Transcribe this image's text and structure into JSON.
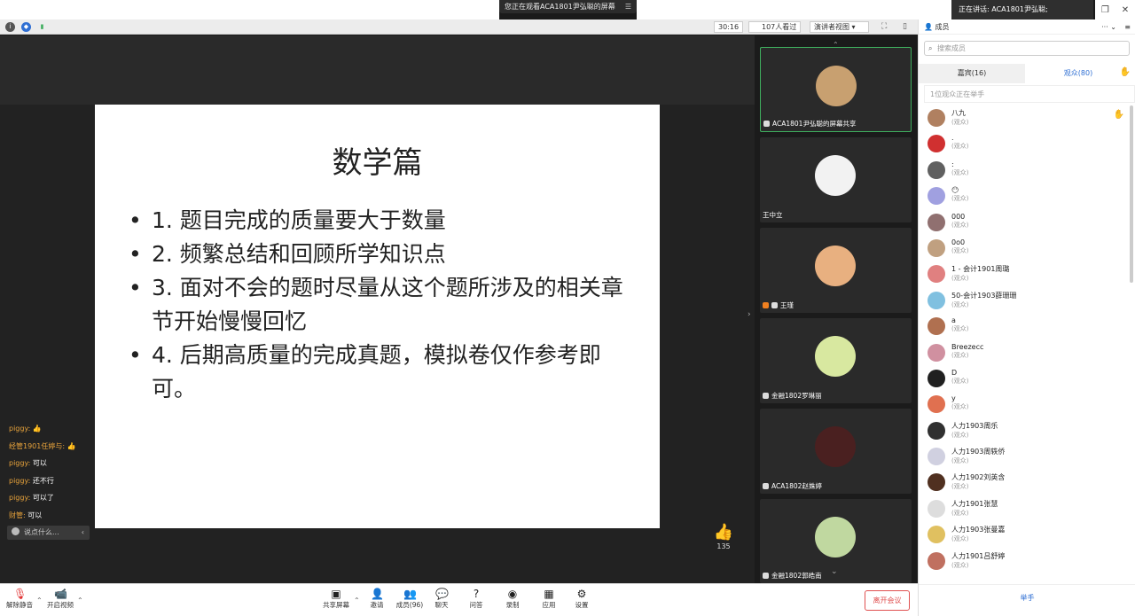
{
  "banner": {
    "text": "您正在观看ACA1801尹弘聪的屏幕"
  },
  "speaker": {
    "text": "正在讲话: ACA1801尹弘聪;"
  },
  "toolbar": {
    "timer": "30:16",
    "viewers": "107人看过",
    "view_mode": "演讲者视图",
    "members_title": "成员"
  },
  "slide": {
    "title": "数学篇",
    "bullets": [
      "1. 题目完成的质量要大于数量",
      "2. 频繁总结和回顾所学知识点",
      "3. 面对不会的题时尽量从这个题所涉及的相关章节开始慢慢回忆",
      "4. 后期高质量的完成真题，模拟卷仅作参考即可。"
    ]
  },
  "chat": {
    "messages": [
      {
        "name": "piggy:",
        "text": "👍"
      },
      {
        "name": "经管1901任婷与:",
        "text": "👍"
      },
      {
        "name": "piggy:",
        "text": "可以"
      },
      {
        "name": "piggy:",
        "text": "还不行"
      },
      {
        "name": "piggy:",
        "text": "可以了"
      },
      {
        "name": "财管:",
        "text": "可以"
      }
    ],
    "placeholder": "说点什么..."
  },
  "likes": {
    "count": "135"
  },
  "videos": [
    {
      "name": "ACA1801尹弘聪的屏幕共享",
      "color": "#c8a070"
    },
    {
      "name": "王中立",
      "color": "#f2f2f2"
    },
    {
      "name": "王瑾",
      "color": "#e8b080"
    },
    {
      "name": "金融1802罗琳丽",
      "color": "#d8e8a0"
    },
    {
      "name": "ACA1802赵姝婷",
      "color": "#4a2020"
    },
    {
      "name": "金融1802郭皓南",
      "color": "#c0d8a0"
    }
  ],
  "panel": {
    "search_placeholder": "搜索成员",
    "tab_hosts": "嘉宾(16)",
    "tab_audience": "观众(80)",
    "hand_banner": "1位观众正在举手",
    "raise_hand": "举手",
    "members": [
      {
        "name": "八九",
        "role": "(观众)",
        "color": "#b08060"
      },
      {
        "name": ".",
        "role": "(观众)",
        "color": "#d03030"
      },
      {
        "name": ":",
        "role": "(观众)",
        "color": "#606060"
      },
      {
        "name": "😶",
        "role": "(观众)",
        "color": "#a0a0e0"
      },
      {
        "name": "000",
        "role": "(观众)",
        "color": "#907070"
      },
      {
        "name": "0o0",
        "role": "(观众)",
        "color": "#c0a080"
      },
      {
        "name": "1 - 会计1901周璐",
        "role": "(观众)",
        "color": "#e08080"
      },
      {
        "name": "50-会计1903薛珊珊",
        "role": "(观众)",
        "color": "#80c0e0"
      },
      {
        "name": "a",
        "role": "(观众)",
        "color": "#b07050"
      },
      {
        "name": "Breezecc",
        "role": "(观众)",
        "color": "#d090a0"
      },
      {
        "name": "D",
        "role": "(观众)",
        "color": "#202020"
      },
      {
        "name": "y",
        "role": "(观众)",
        "color": "#e07050"
      },
      {
        "name": "人力1903周乐",
        "role": "(观众)",
        "color": "#303030"
      },
      {
        "name": "人力1903周轶侨",
        "role": "(观众)",
        "color": "#d0d0e0"
      },
      {
        "name": "人力1902刘英含",
        "role": "(观众)",
        "color": "#503020"
      },
      {
        "name": "人力1901张慧",
        "role": "(观众)",
        "color": "#dddddd"
      },
      {
        "name": "人力1903张曼嘉",
        "role": "(观众)",
        "color": "#e0c060"
      },
      {
        "name": "人力1901吕舒婷",
        "role": "(观众)",
        "color": "#c07060"
      }
    ]
  },
  "bottom": {
    "mute": "解除静音",
    "video": "开启视频",
    "share": "共享屏幕",
    "invite": "邀请",
    "members": "成员(96)",
    "chat": "聊天",
    "qa": "问答",
    "record": "录制",
    "apps": "应用",
    "settings": "设置",
    "leave": "离开会议"
  }
}
